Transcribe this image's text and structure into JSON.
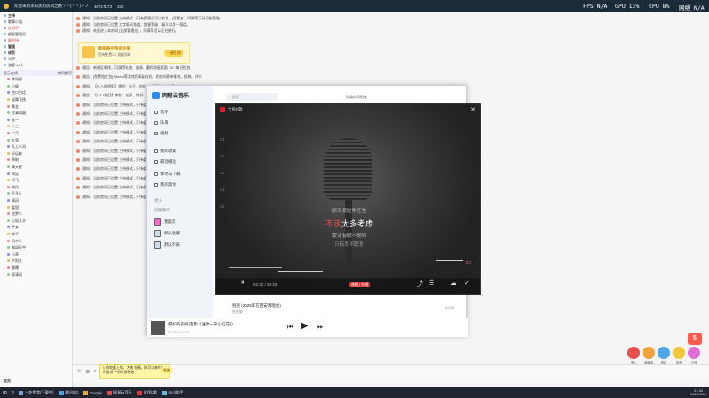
{
  "titlebar": {
    "title": "欢迎来到李阳黑的房间之路ヽ丶(ヽ丶)ノノ",
    "id": "40717173",
    "online": "152"
  },
  "stats": {
    "fps": "FPS N/A",
    "gpu": "GPU 13%",
    "cpu": "CPU 8%",
    "net": "网络 N/A"
  },
  "sidebar": {
    "items": [
      {
        "label": "主持",
        "style": "group"
      },
      {
        "label": "歌舞小组",
        "style": "normal"
      },
      {
        "label": "红马甲",
        "style": "red"
      },
      {
        "label": "超级管理员",
        "style": "normal"
      },
      {
        "label": "副主持",
        "style": "red"
      },
      {
        "label": "管理",
        "style": "group"
      },
      {
        "label": "成员",
        "style": "group"
      },
      {
        "label": "马甲",
        "style": "normal"
      },
      {
        "label": "游客 19人",
        "style": "normal"
      }
    ],
    "filter_label": "显示在线",
    "sort_label": "房间排序",
    "users": [
      "李丹妮",
      "小辉",
      "空口白话",
      "轻舞飞扬",
      "黄金",
      "往事如烟",
      "念一",
      "十三",
      "二月",
      "大哥",
      "天上人间",
      "好运来",
      "草根",
      "满天星",
      "知足",
      "阿飞",
      "南风",
      "平凡人",
      "清风",
      "爱国",
      "追梦人",
      "心如止水",
      "平安",
      "林子",
      "风中人",
      "海阔天空",
      "小草",
      "夕阳红",
      "晨曦",
      "醉清风"
    ],
    "bottom_label": "会员"
  },
  "chat": {
    "lines": [
      "通知：当前房间已设置 主持模式，只有管理员可以发言。[观看者，同演等互动可能受限]",
      "通知：当前房间已设置 文字聊天频道，游客等级 1 级可以发一段话。",
      "通知：欢迎进入本房间 [全部管理员] ，同演等活动正在进行。",
      "通告：新增区域榜，可获得礼物、道具，赢得流星奖励（0.1每日任务）",
      "通告：[免费抢红包] Steam等游戏的高级存档，拍房间榜单排名，投稿，评价",
      "通知：【十八线明星】李阳：仙子，你好！欢迎进入本房间",
      "通告：【1人7老回】李阳：仙子，你好！欢迎进入本房间",
      "通知：当前房间已设置 主持模式，只有管理员可以发言。",
      "通知：当前房间已设置 主持模式，只有管理员可以发言。",
      "通知：当前房间已设置 主持模式，只有管理员可以发言。",
      "通知：当前房间已设置 主持模式，只有管理员可以发言。",
      "通知：当前房间已设置 主持模式，只有管理员可以发言。",
      "通知：当前房间已设置 主持模式，只有管理员可以发言。",
      "通知：当前房间已设置 主持模式，只有管理员可以发言。",
      "通知：当前房间已设置 主持模式，只有管理员可以发言。",
      "通知：当前房间已设置 主持模式，只有管理员可以发言。",
      "通知：当前房间已设置 主持模式，只有管理员可以发言。",
      "通知：当前房间已设置 主持模式，只有管理员可以发言。"
    ],
    "promo_title": "网易账号快速注册",
    "promo_desc": "您有免费2G 流量领取",
    "promo_button": "一键注册"
  },
  "music": {
    "app_name": "网易云音乐",
    "search_placeholder": "搜索",
    "user": "凤凰传奇歌迷",
    "nav": [
      "音乐",
      "乐库",
      "视频",
      "我的收藏",
      "最近播放",
      "本地与下载",
      "我的歌单"
    ],
    "section_label": "更多",
    "playlist_header": "创建歌单",
    "playlists": [
      "我喜欢",
      "默认收藏",
      "默认列表"
    ],
    "song_title": "最好的安排(电影《送你一朵小红花》)",
    "song_time": "00:35 / 04:02",
    "track_title": "别哭 (2025年在西安演唱会)",
    "track_artist": "徐良安",
    "track_duration": "03:34"
  },
  "lyric": {
    "app_name": "全民K歌",
    "line1": "原来爱是种任性",
    "line2_pre": "不该",
    "line2_hl": "太多考虑",
    "line3": "爱没有聪不聪明",
    "line4": "只有愿不愿意",
    "time": "02:32 / 04:33",
    "badge": "原唱 | 伴唱",
    "vol": "0:2"
  },
  "input": {
    "bubble_text": "让你吃饭上钩，大他 祝福，你可以来吗？你尝试 一份大数开始",
    "tag": "发送"
  },
  "gifts": [
    "爱心",
    "棒棒糖",
    "鲜花",
    "金币",
    "王冠"
  ],
  "five_badge": "5",
  "taskbar": {
    "items": [
      "小吃零食(下载中)",
      "腾讯QQ",
      "Google",
      "网易云音乐",
      "全民K歌",
      "AI小助手"
    ],
    "clock_time": "21:34",
    "clock_date": "2025/4/18"
  }
}
